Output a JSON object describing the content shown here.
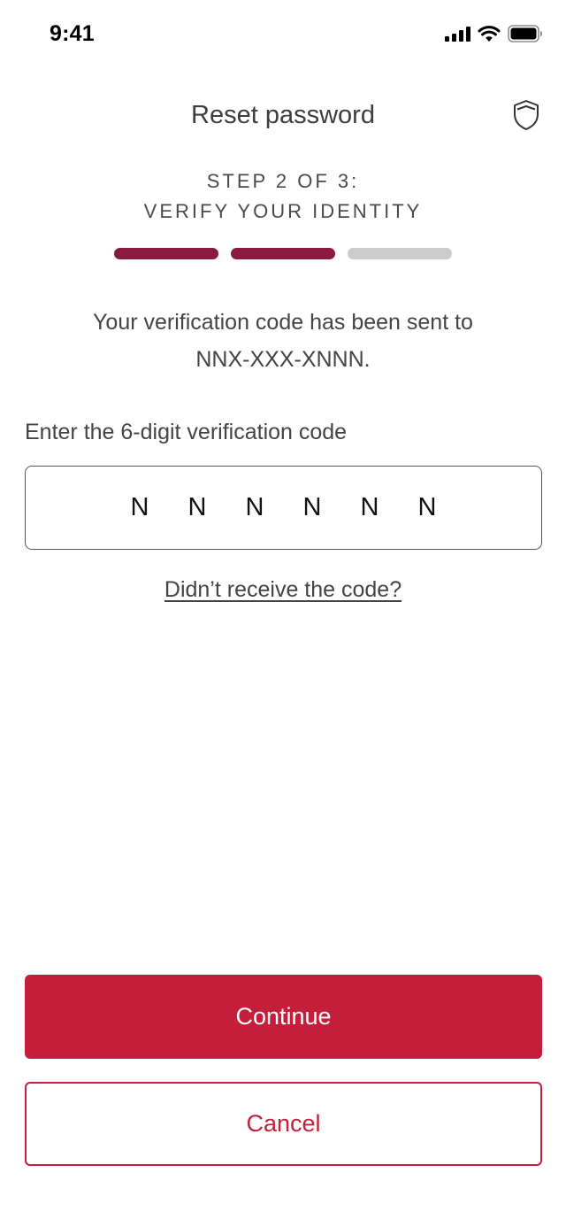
{
  "status_bar": {
    "time": "9:41",
    "icons": [
      "signal-icon",
      "wifi-icon",
      "battery-icon"
    ]
  },
  "header": {
    "title": "Reset password",
    "right_icon": "shield-icon"
  },
  "step": {
    "line1": "STEP 2 OF 3:",
    "line2": "VERIFY YOUR IDENTITY",
    "current": 2,
    "total": 3
  },
  "message": {
    "line1": "Your verification code has been sent to",
    "line2": "NNX-XXX-XNNN."
  },
  "code_field": {
    "label": "Enter the 6-digit verification code",
    "digits": [
      "N",
      "N",
      "N",
      "N",
      "N",
      "N"
    ]
  },
  "resend_link": "Didn’t receive the code?",
  "buttons": {
    "continue": "Continue",
    "cancel": "Cancel"
  },
  "colors": {
    "accent": "#c41e3a",
    "progress_active": "#8b1a40",
    "progress_inactive": "#cccccc"
  }
}
